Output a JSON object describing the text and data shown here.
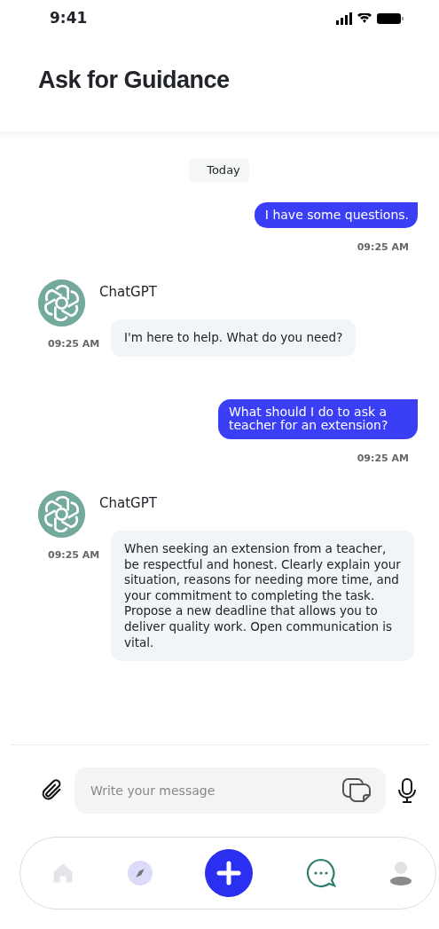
{
  "status_bar": {
    "time": "9:41"
  },
  "title": "Ask for Guidance",
  "date_chip": "Today",
  "messages": [
    {
      "kind": "sent",
      "text": "I have some questions.",
      "time": "09:25 AM"
    },
    {
      "kind": "received",
      "sender": "ChatGPT",
      "text": "I'm here to help. What do you need?",
      "time": "09:25 AM"
    },
    {
      "kind": "sent",
      "text": "What should I do to ask a teacher for an extension?",
      "time": "09:25 AM"
    },
    {
      "kind": "received",
      "sender": "ChatGPT",
      "text": "When seeking an extension from a teacher, be respectful and honest. Clearly explain your situation, reasons for needing more time, and your commitment to completing the task. Propose a new deadline that allows you to deliver quality work. Open communication is vital.",
      "time": "09:25 AM"
    }
  ],
  "composer": {
    "placeholder": "Write your message"
  },
  "nav": [
    {
      "kind": "home",
      "selected": false
    },
    {
      "kind": "explore",
      "selected": false
    },
    {
      "kind": "add",
      "selected": false
    },
    {
      "kind": "chat",
      "selected": true
    },
    {
      "kind": "profile",
      "selected": false
    }
  ]
}
